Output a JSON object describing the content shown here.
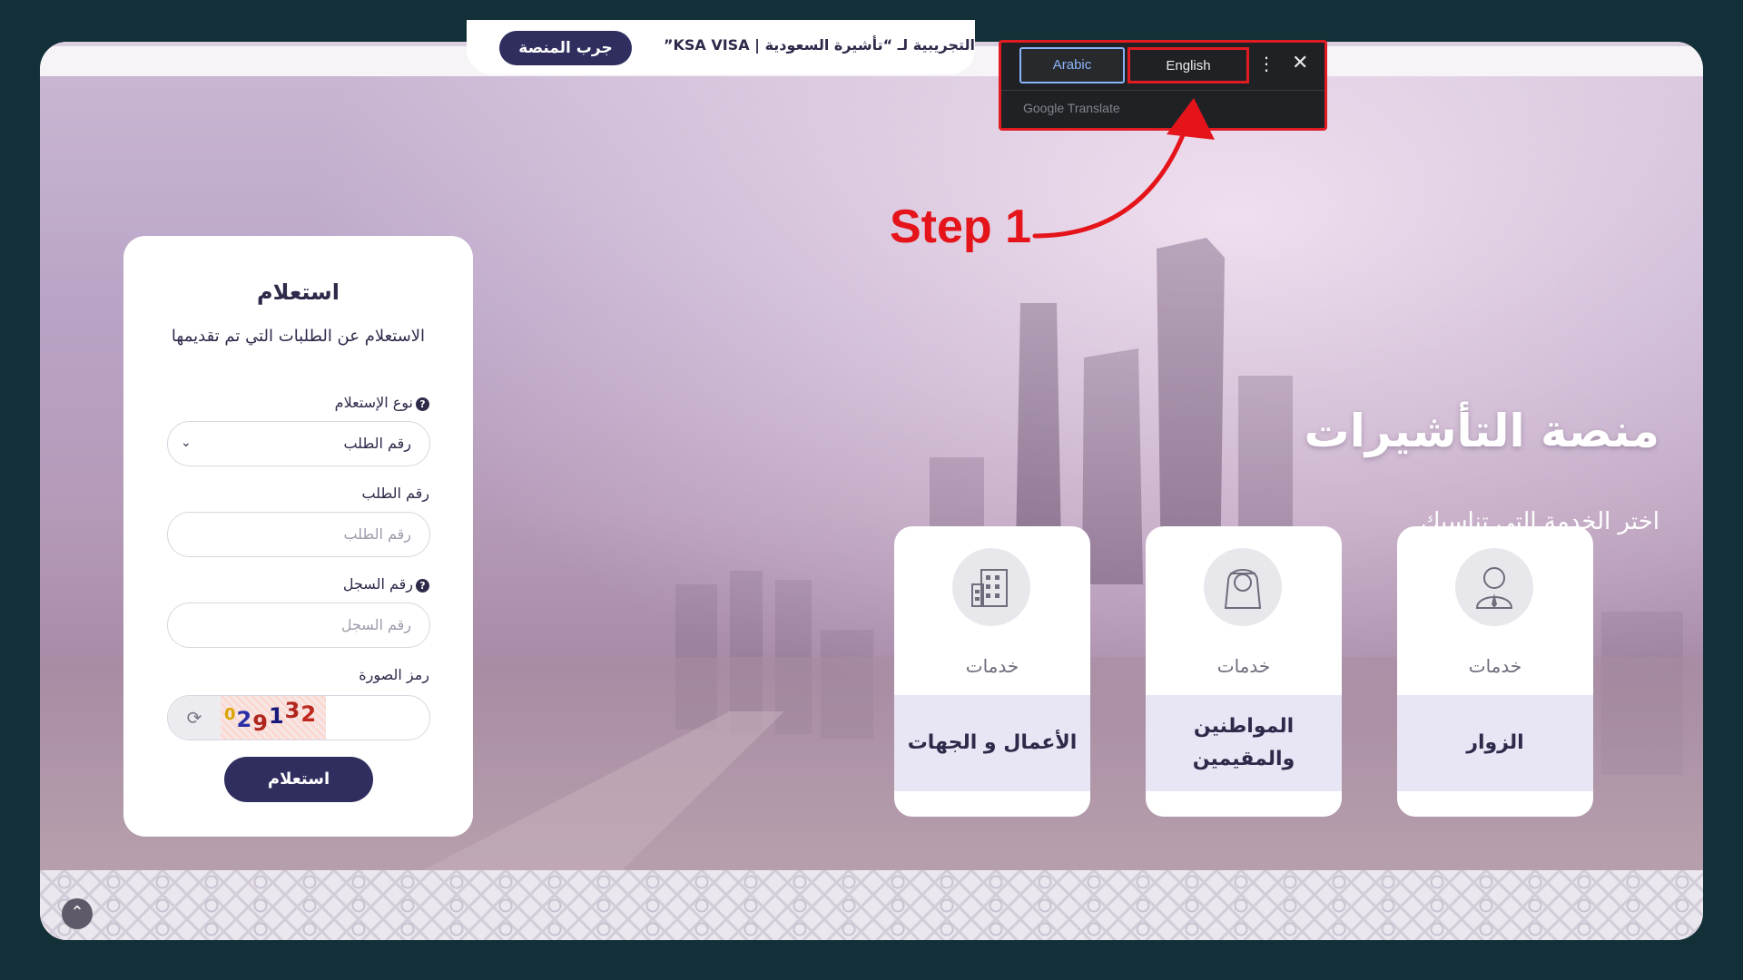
{
  "announcement": {
    "text": "التجريبية لـ “تأشيرة السعودية | KSA VISA”",
    "try_button": "جرب المنصة"
  },
  "translate_popup": {
    "tab_arabic": "Arabic",
    "tab_english": "English",
    "more_icon": "⋮",
    "close_icon": "✕",
    "brand": "Google Translate"
  },
  "annotation": {
    "step_label": "Step 1",
    "color": "#e4141a"
  },
  "inquiry": {
    "title": "استعلام",
    "description": "الاستعلام عن الطلبات التي تم تقديمها",
    "type_label": "نوع الإستعلام",
    "type_selected": "رقم الطلب",
    "request_label": "رقم الطلب",
    "request_placeholder": "رقم الطلب",
    "record_label": "رقم السجل",
    "record_placeholder": "رقم السجل",
    "captcha_label": "رمز الصورة",
    "captcha_chars": [
      "0",
      "2",
      "9",
      "1",
      "3",
      "2"
    ],
    "captcha_colors": [
      "#d9a400",
      "#2a2fa6",
      "#b0261e",
      "#1a1a7a",
      "#b0261e",
      "#c0271e"
    ],
    "submit": "استعلام"
  },
  "hero": {
    "title": "منصة التأشيرات",
    "subtitle": "اختر الخدمة التي تناسبك"
  },
  "services": [
    {
      "prefix": "خدمات",
      "name": "الزوار",
      "icon": "visitor-icon"
    },
    {
      "prefix": "خدمات",
      "name": "المواطنين والمقيمين",
      "icon": "citizen-icon"
    },
    {
      "prefix": "خدمات",
      "name": "الأعمال و الجهات",
      "icon": "building-icon"
    }
  ],
  "colors": {
    "primary": "#2f2e5e",
    "page_background": "#133038"
  }
}
